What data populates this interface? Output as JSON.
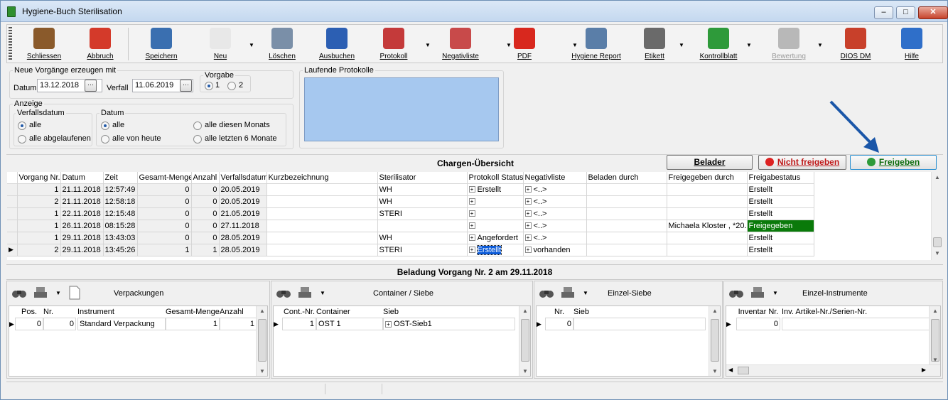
{
  "window": {
    "title": "Hygiene-Buch Sterilisation",
    "min": "–",
    "max": "□",
    "close": "✕"
  },
  "toolbar": {
    "items": [
      {
        "label": "Schliessen",
        "icon": "door-exit-icon",
        "color": "#8a5a2b"
      },
      {
        "label": "Abbruch",
        "icon": "cancel-icon",
        "color": "#d43a2a"
      },
      {
        "label": "Speichern",
        "icon": "save-icon",
        "color": "#3a6fb0"
      },
      {
        "label": "Neu",
        "icon": "new-document-icon",
        "color": "#e8e8e8"
      },
      {
        "label": "Löschen",
        "icon": "trash-icon",
        "color": "#7a8fa8"
      },
      {
        "label": "Ausbuchen",
        "icon": "book-icon",
        "color": "#2c5fb3"
      },
      {
        "label": "Protokoll",
        "icon": "protocol-icon",
        "color": "#c43a3a"
      },
      {
        "label": "Negativliste",
        "icon": "clipboard-icon",
        "color": "#c84a4a"
      },
      {
        "label": "PDF",
        "icon": "pdf-icon",
        "color": "#d8281e"
      },
      {
        "label": "Hygiene Report",
        "icon": "report-icon",
        "color": "#5a7ea8"
      },
      {
        "label": "Etikett",
        "icon": "label-printer-icon",
        "color": "#6a6a6a"
      },
      {
        "label": "Kontrollblatt",
        "icon": "checklist-icon",
        "color": "#2e9a3a"
      },
      {
        "label": "Bewertung",
        "icon": "chart-icon",
        "color": "#b8b8b8"
      },
      {
        "label": "DIOS DM",
        "icon": "dios-qm-icon",
        "color": "#c8402a"
      },
      {
        "label": "Hilfe",
        "icon": "help-icon",
        "color": "#2f6fc9"
      }
    ]
  },
  "neue": {
    "title": "Neue Vorgänge erzeugen mit",
    "datum_label": "Datum",
    "datum": "13.12.2018",
    "verfall_label": "Verfall",
    "verfall": "11.06.2019",
    "vorgabe_label": "Vorgabe",
    "v1": "1",
    "v2": "2"
  },
  "anzeige": {
    "title": "Anzeige",
    "verf_title": "Verfallsdatum",
    "r_alle": "alle",
    "r_abgelaufen": "alle abgelaufenen",
    "datum_title": "Datum",
    "d_alle": "alle",
    "d_heute": "alle von heute",
    "d_monat": "alle diesen Monats",
    "d_6monate": "alle letzten 6 Monate"
  },
  "laufende": {
    "title": "Laufende Protokolle"
  },
  "chargen": {
    "title": "Chargen-Übersicht",
    "btn_belader": "Belader",
    "btn_nicht": "Nicht freigeben",
    "btn_frei": "Freigeben",
    "columns": [
      "Vorgang Nr.",
      "Datum",
      "Zeit",
      "Gesamt-Menge",
      "Anzahl",
      "Verfallsdatum",
      "Kurzbezeichnung",
      "Sterilisator",
      "Protokoll Status",
      "Negativliste",
      "Beladen durch",
      "Freigegeben durch",
      "Freigabestatus"
    ],
    "rows": [
      {
        "nr": "1",
        "datum": "21.11.2018",
        "zeit": "12:57:49",
        "menge": "0",
        "anzahl": "0",
        "verfall": "20.05.2019",
        "kurz": "",
        "steri": "WH",
        "proto": "Erstellt",
        "neg": "<..>",
        "beladen": "",
        "frei_durch": "",
        "status": "Erstellt"
      },
      {
        "nr": "2",
        "datum": "21.11.2018",
        "zeit": "12:58:18",
        "menge": "0",
        "anzahl": "0",
        "verfall": "20.05.2019",
        "kurz": "",
        "steri": "WH",
        "proto": "",
        "neg": "<..>",
        "beladen": "",
        "frei_durch": "",
        "status": "Erstellt"
      },
      {
        "nr": "1",
        "datum": "22.11.2018",
        "zeit": "12:15:48",
        "menge": "0",
        "anzahl": "0",
        "verfall": "21.05.2019",
        "kurz": "",
        "steri": "STERI",
        "proto": "",
        "neg": "<..>",
        "beladen": "",
        "frei_durch": "",
        "status": "Erstellt"
      },
      {
        "nr": "1",
        "datum": "26.11.2018",
        "zeit": "08:15:28",
        "menge": "0",
        "anzahl": "0",
        "verfall": "27.11.2018",
        "kurz": "",
        "steri": "",
        "proto": "",
        "neg": "<..>",
        "beladen": "",
        "frei_durch": "Michaela  Kloster , *20.",
        "status": "Freigegeben"
      },
      {
        "nr": "1",
        "datum": "29.11.2018",
        "zeit": "13:43:03",
        "menge": "0",
        "anzahl": "0",
        "verfall": "28.05.2019",
        "kurz": "",
        "steri": "WH",
        "proto": "Angefordert",
        "neg": "<..>",
        "beladen": "",
        "frei_durch": "",
        "status": "Erstellt"
      },
      {
        "nr": "2",
        "datum": "29.11.2018",
        "zeit": "13:45:26",
        "menge": "1",
        "anzahl": "1",
        "verfall": "28.05.2019",
        "kurz": "",
        "steri": "STERI",
        "proto": "Erstellt",
        "neg": "vorhanden",
        "beladen": "",
        "frei_durch": "",
        "status": "Erstellt"
      }
    ]
  },
  "beladung": {
    "title": "Beladung Vorgang Nr. 2 am 29.11.2018"
  },
  "verpackungen": {
    "title": "Verpackungen",
    "columns": [
      "Pos.",
      "Nr.",
      "Instrument",
      "Gesamt-Menge",
      "Anzahl"
    ],
    "row": {
      "pos": "0",
      "nr": "0",
      "instrument": "Standard Verpackung",
      "menge": "1",
      "anzahl": "1"
    }
  },
  "container": {
    "title": "Container / Siebe",
    "columns": [
      "Cont.-Nr.",
      "Container",
      "Sieb"
    ],
    "row": {
      "nr": "1",
      "container": "OST 1",
      "sieb": "OST-Sieb1"
    }
  },
  "einzelsiebe": {
    "title": "Einzel-Siebe",
    "columns": [
      "Nr.",
      "Sieb"
    ],
    "row": {
      "nr": "0",
      "sieb": ""
    }
  },
  "instrumente": {
    "title": "Einzel-Instrumente",
    "columns": [
      "Inventar Nr.",
      "Inv. Artikel-Nr./Serien-Nr."
    ],
    "row": {
      "nr": "0",
      "art": ""
    }
  },
  "colors": {
    "freigegeben": "#0a7a0a",
    "arrow": "#1a56a8",
    "protoBox": "#a6c8ef"
  }
}
